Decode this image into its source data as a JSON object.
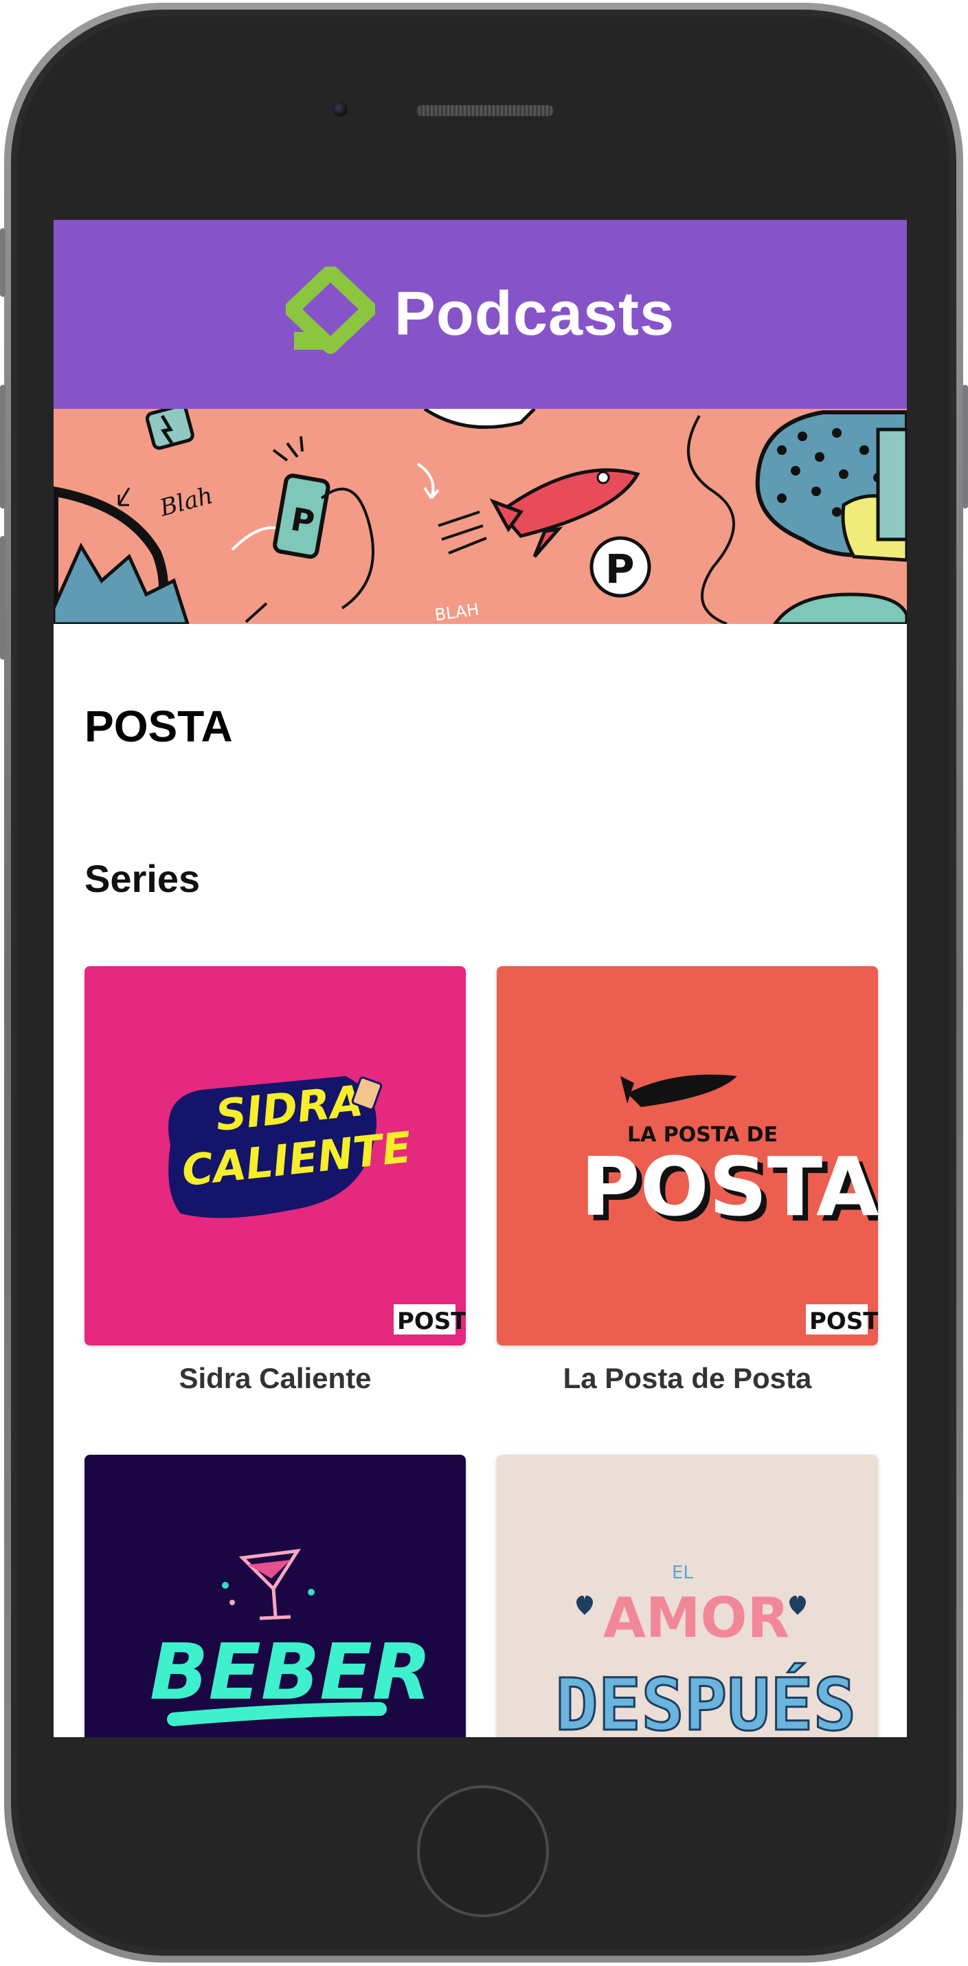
{
  "app": {
    "title": "Podcasts"
  },
  "page": {
    "title": "POSTA"
  },
  "section": {
    "title": "Series"
  },
  "series": [
    {
      "name": "Sidra Caliente",
      "art_text": [
        "SIDRA",
        "CALIENTE"
      ],
      "badge": "POSTA",
      "bg": "#e4297e"
    },
    {
      "name": "La Posta de Posta",
      "art_text": [
        "LA POSTA DE",
        "POSTA"
      ],
      "badge": "POSTA",
      "bg": "#ec5e4f"
    },
    {
      "name": "",
      "art_text": [
        "BEBER"
      ],
      "bg": "#1a0642"
    },
    {
      "name": "",
      "art_text": [
        "EL",
        "AMOR",
        "DESPUÉS"
      ],
      "bg": "#ebded6"
    }
  ],
  "banner": {
    "doodles": [
      "Blah",
      "BLAH",
      "P",
      "P"
    ]
  },
  "colors": {
    "header": "#8654c8",
    "logo": "#8cc63f",
    "banner": "#f39b86"
  },
  "icons": [
    "podcasts-logo-icon",
    "rocket-icon",
    "phone-icon"
  ]
}
